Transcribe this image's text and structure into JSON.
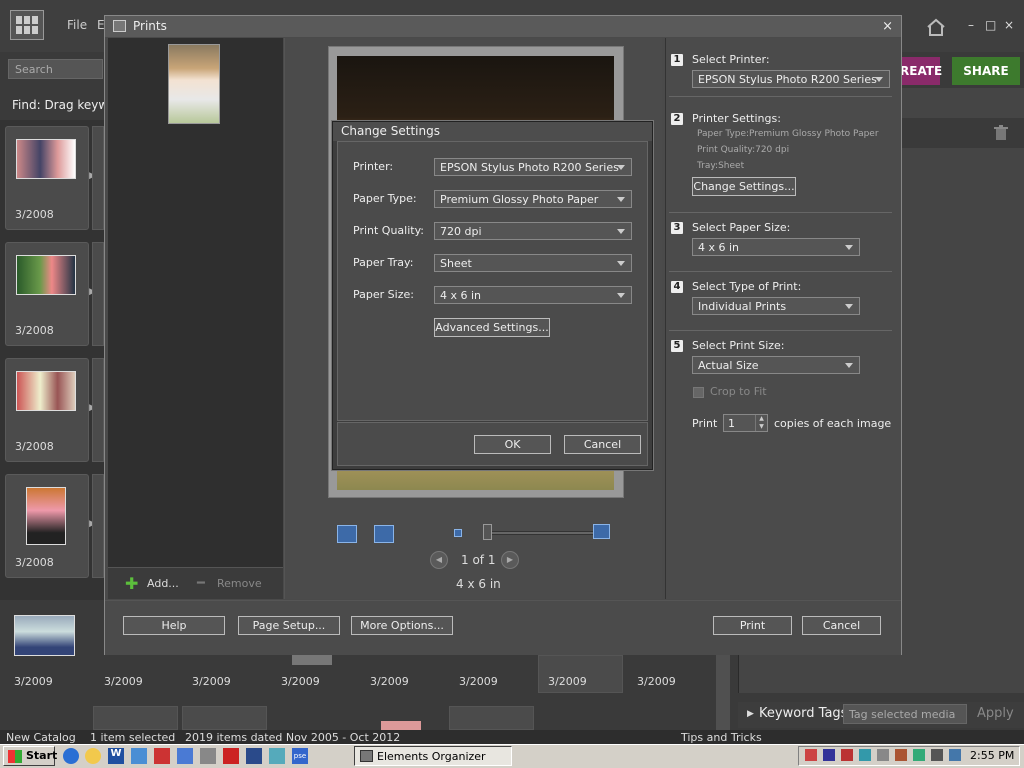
{
  "organizer": {
    "menu": [
      "File",
      "E"
    ],
    "search_placeholder": "Search",
    "find_text": "Find: Drag keywo",
    "create_label": "REATE",
    "share_label": "SHARE",
    "window_controls": [
      "–",
      "□",
      "×"
    ],
    "left_cards": [
      {
        "date": "3/2008"
      },
      {
        "date": "3/2008"
      },
      {
        "date": "3/2008"
      },
      {
        "date": "3/2008"
      }
    ],
    "bottom_dates": [
      "3/2009",
      "3/2009",
      "3/2009",
      "3/2009",
      "3/2009",
      "3/2009",
      "3/2009",
      "3/2009"
    ],
    "status_left": "New Catalog",
    "status_selected": "1 item selected",
    "status_count": "2019 items dated Nov 2005 - Oct 2012",
    "status_tips": "Tips and Tricks",
    "keyword_tags_label": "Keyword Tags",
    "tag_placeholder": "Tag selected media",
    "apply_label": "Apply"
  },
  "prints": {
    "title": "Prints",
    "close": "×",
    "add_label": "Add...",
    "remove_label": "Remove",
    "page_indicator": "1 of 1",
    "print_size_caption": "4 x 6 in",
    "steps": [
      {
        "num": "1",
        "label": "Select Printer:",
        "value": "EPSON Stylus Photo R200 Series"
      },
      {
        "num": "2",
        "label": "Printer Settings:",
        "info": [
          "Paper Type:Premium Glossy Photo Paper",
          "Print Quality:720 dpi",
          "Tray:Sheet"
        ],
        "button": "Change Settings..."
      },
      {
        "num": "3",
        "label": "Select Paper Size:",
        "value": "4 x 6 in"
      },
      {
        "num": "4",
        "label": "Select Type of Print:",
        "value": "Individual Prints"
      },
      {
        "num": "5",
        "label": "Select Print Size:",
        "value": "Actual Size"
      }
    ],
    "crop_label": "Crop to Fit",
    "copies_prefix": "Print",
    "copies_value": "1",
    "copies_suffix": "copies of each image",
    "footer": {
      "help": "Help",
      "page_setup": "Page Setup...",
      "more_options": "More Options...",
      "print": "Print",
      "cancel": "Cancel"
    }
  },
  "change_settings": {
    "title": "Change Settings",
    "fields": [
      {
        "label": "Printer:",
        "value": "EPSON Stylus Photo R200 Series"
      },
      {
        "label": "Paper Type:",
        "value": "Premium Glossy Photo Paper"
      },
      {
        "label": "Print Quality:",
        "value": "720 dpi"
      },
      {
        "label": "Paper Tray:",
        "value": "Sheet"
      },
      {
        "label": "Paper Size:",
        "value": "4 x 6 in"
      }
    ],
    "advanced": "Advanced Settings...",
    "ok": "OK",
    "cancel": "Cancel"
  },
  "taskbar": {
    "start": "Start",
    "active_app": "Elements Organizer",
    "time": "2:55 PM"
  },
  "colors": {
    "dialog_bg": "#4a4a4a",
    "share_green": "#3d7a2d",
    "create_purple": "#8a2a6a",
    "taskbar": "#d4d0c8"
  }
}
